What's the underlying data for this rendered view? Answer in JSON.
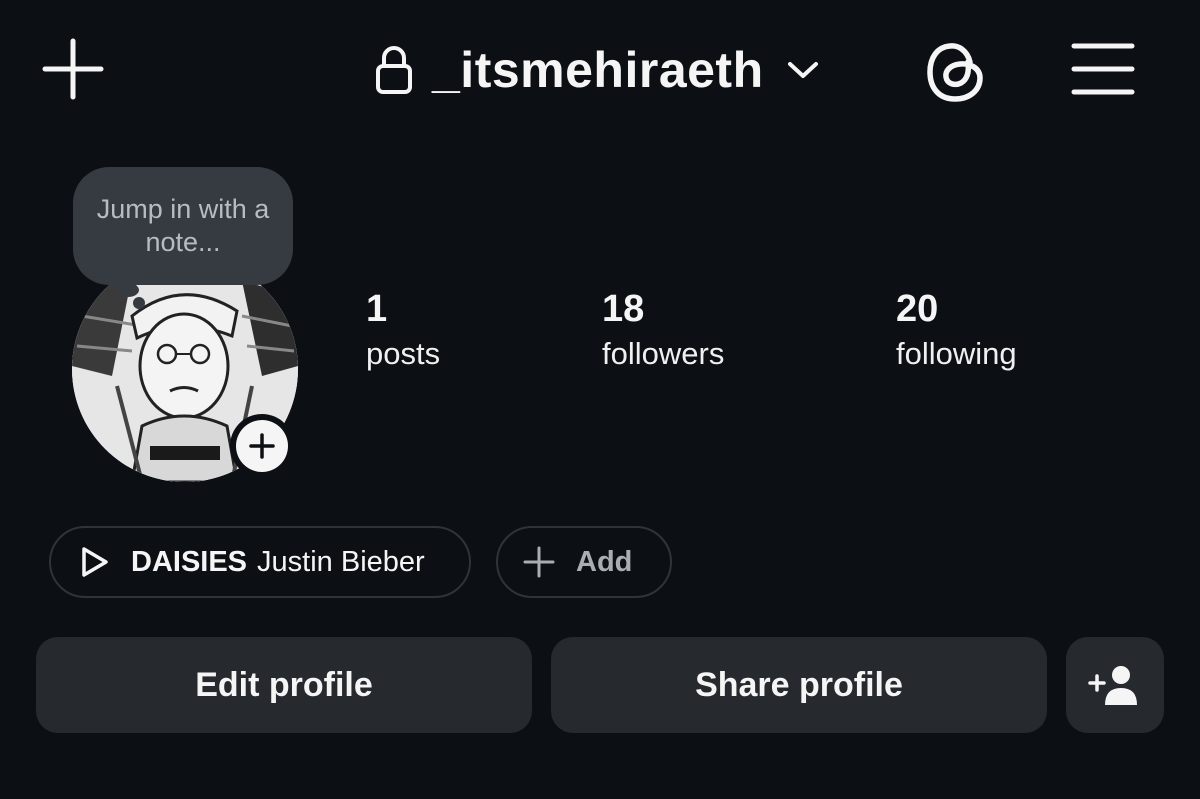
{
  "header": {
    "create_icon": "plus-icon",
    "username": "_itsmehiraeth",
    "private_icon": "lock-icon",
    "switch_icon": "chevron-down-icon",
    "threads_icon": "threads-icon",
    "menu_icon": "hamburger-menu-icon"
  },
  "note": {
    "placeholder": "Jump in with a note..."
  },
  "stats": {
    "posts": {
      "value": "1",
      "label": "posts"
    },
    "followers": {
      "value": "18",
      "label": "followers"
    },
    "following": {
      "value": "20",
      "label": "following"
    }
  },
  "music": {
    "song": "DAISIES",
    "artist": "Justin Bieber"
  },
  "add_pill": {
    "label": "Add"
  },
  "actions": {
    "edit_label": "Edit profile",
    "share_label": "Share profile",
    "discover_icon": "add-person-icon"
  },
  "colors": {
    "background": "#0c1014",
    "button": "#262a2f",
    "note_bubble": "#363b41",
    "text": "#f5f5f5"
  }
}
